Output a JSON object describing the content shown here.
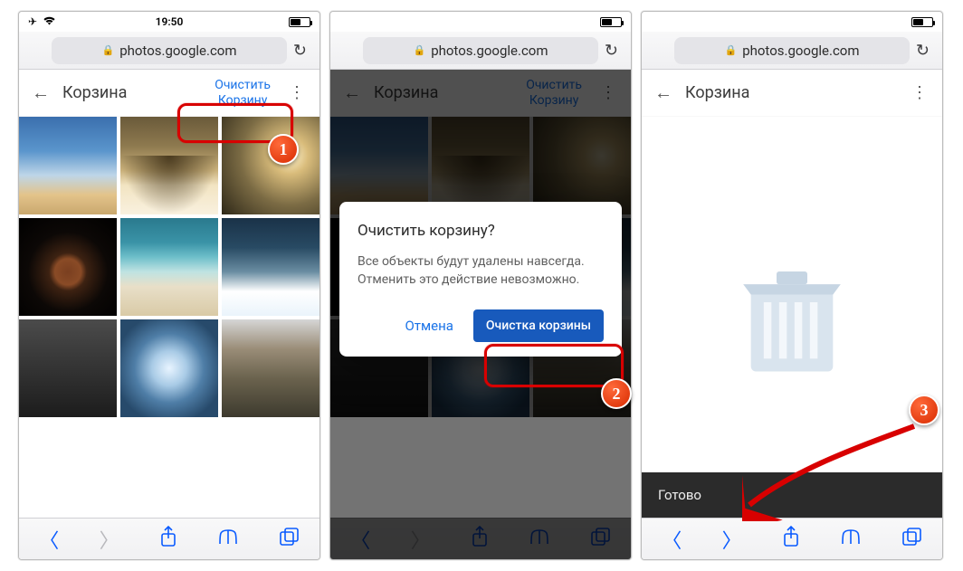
{
  "status": {
    "time": "19:50"
  },
  "url": {
    "host": "photos.google.com"
  },
  "screen1": {
    "title": "Корзина",
    "clear_line1": "Очистить",
    "clear_line2": "Корзину"
  },
  "screen2": {
    "title": "Корзина",
    "clear_line1": "Очистить",
    "clear_line2": "Корзину",
    "dialog": {
      "title": "Очистить корзину?",
      "body": "Все объекты будут удалены навсегда. Отменить это действие невозможно.",
      "cancel": "Отмена",
      "confirm": "Очистка корзины"
    }
  },
  "screen3": {
    "title": "Корзина",
    "toast": "Готово"
  },
  "annotations": {
    "b1": "1",
    "b2": "2",
    "b3": "3"
  }
}
